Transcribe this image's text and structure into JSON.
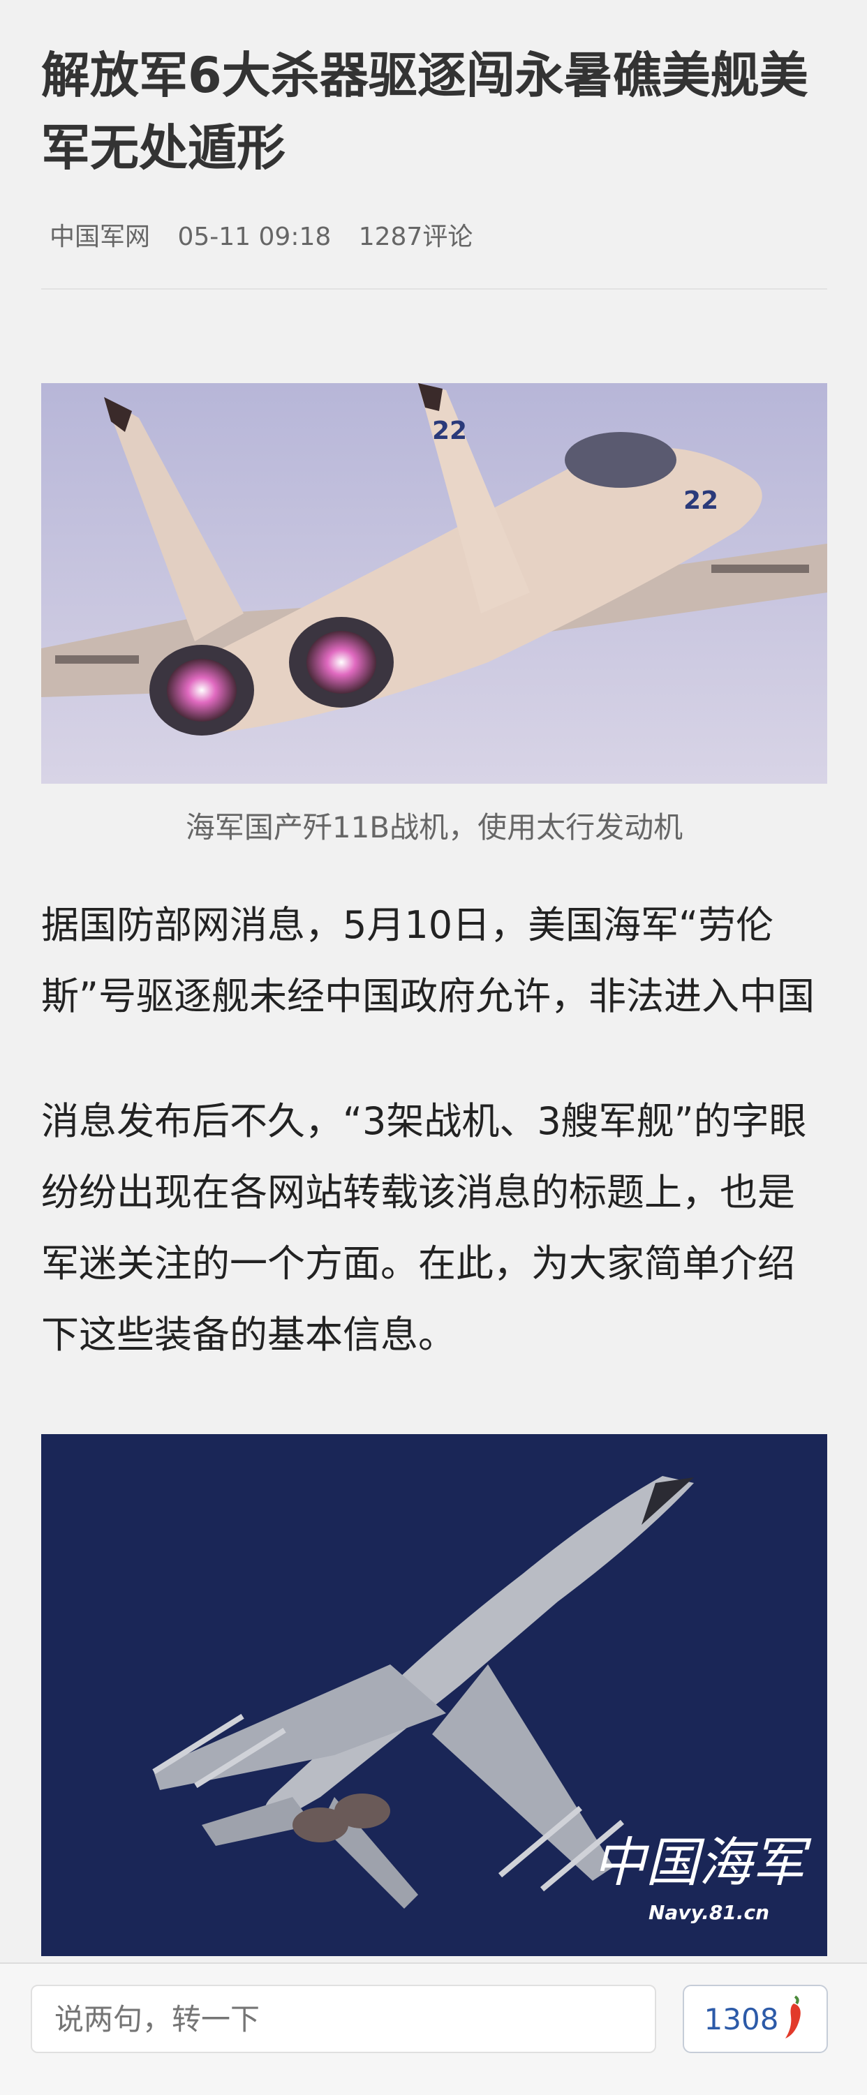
{
  "article": {
    "title": "解放军6大杀器驱逐闯永暑礁美舰美军无处遁形",
    "source": "中国军网",
    "time": "05-11 09:18",
    "comments": "1287评论",
    "image1_caption": "海军国产歼11B战机，使用太行发动机",
    "para1": "据国防部网消息，5月10日，美国海军“劳伦斯”号驱逐舰未经中国政府允许，非法进入中国南沙群岛有关岛礁邻近海域。",
    "para2": "消息发布后不久，“3架战机、3艘军舰”的字眼纷纷出现在各网站转载该消息的标题上，也是军迷关注的一个方面。在此，为大家简单介绍下这些装备的基本信息。",
    "image2_watermark_cn": "中国海军",
    "image2_watermark_url": "Navy.81.cn"
  },
  "bottom_bar": {
    "input_placeholder": "说两句，转一下",
    "comment_count": "1308",
    "icon": "chili-pepper-icon"
  },
  "colors": {
    "background": "#f1f1f1",
    "accent_blue": "#2c5aa8",
    "pepper_red": "#e23a2a"
  }
}
